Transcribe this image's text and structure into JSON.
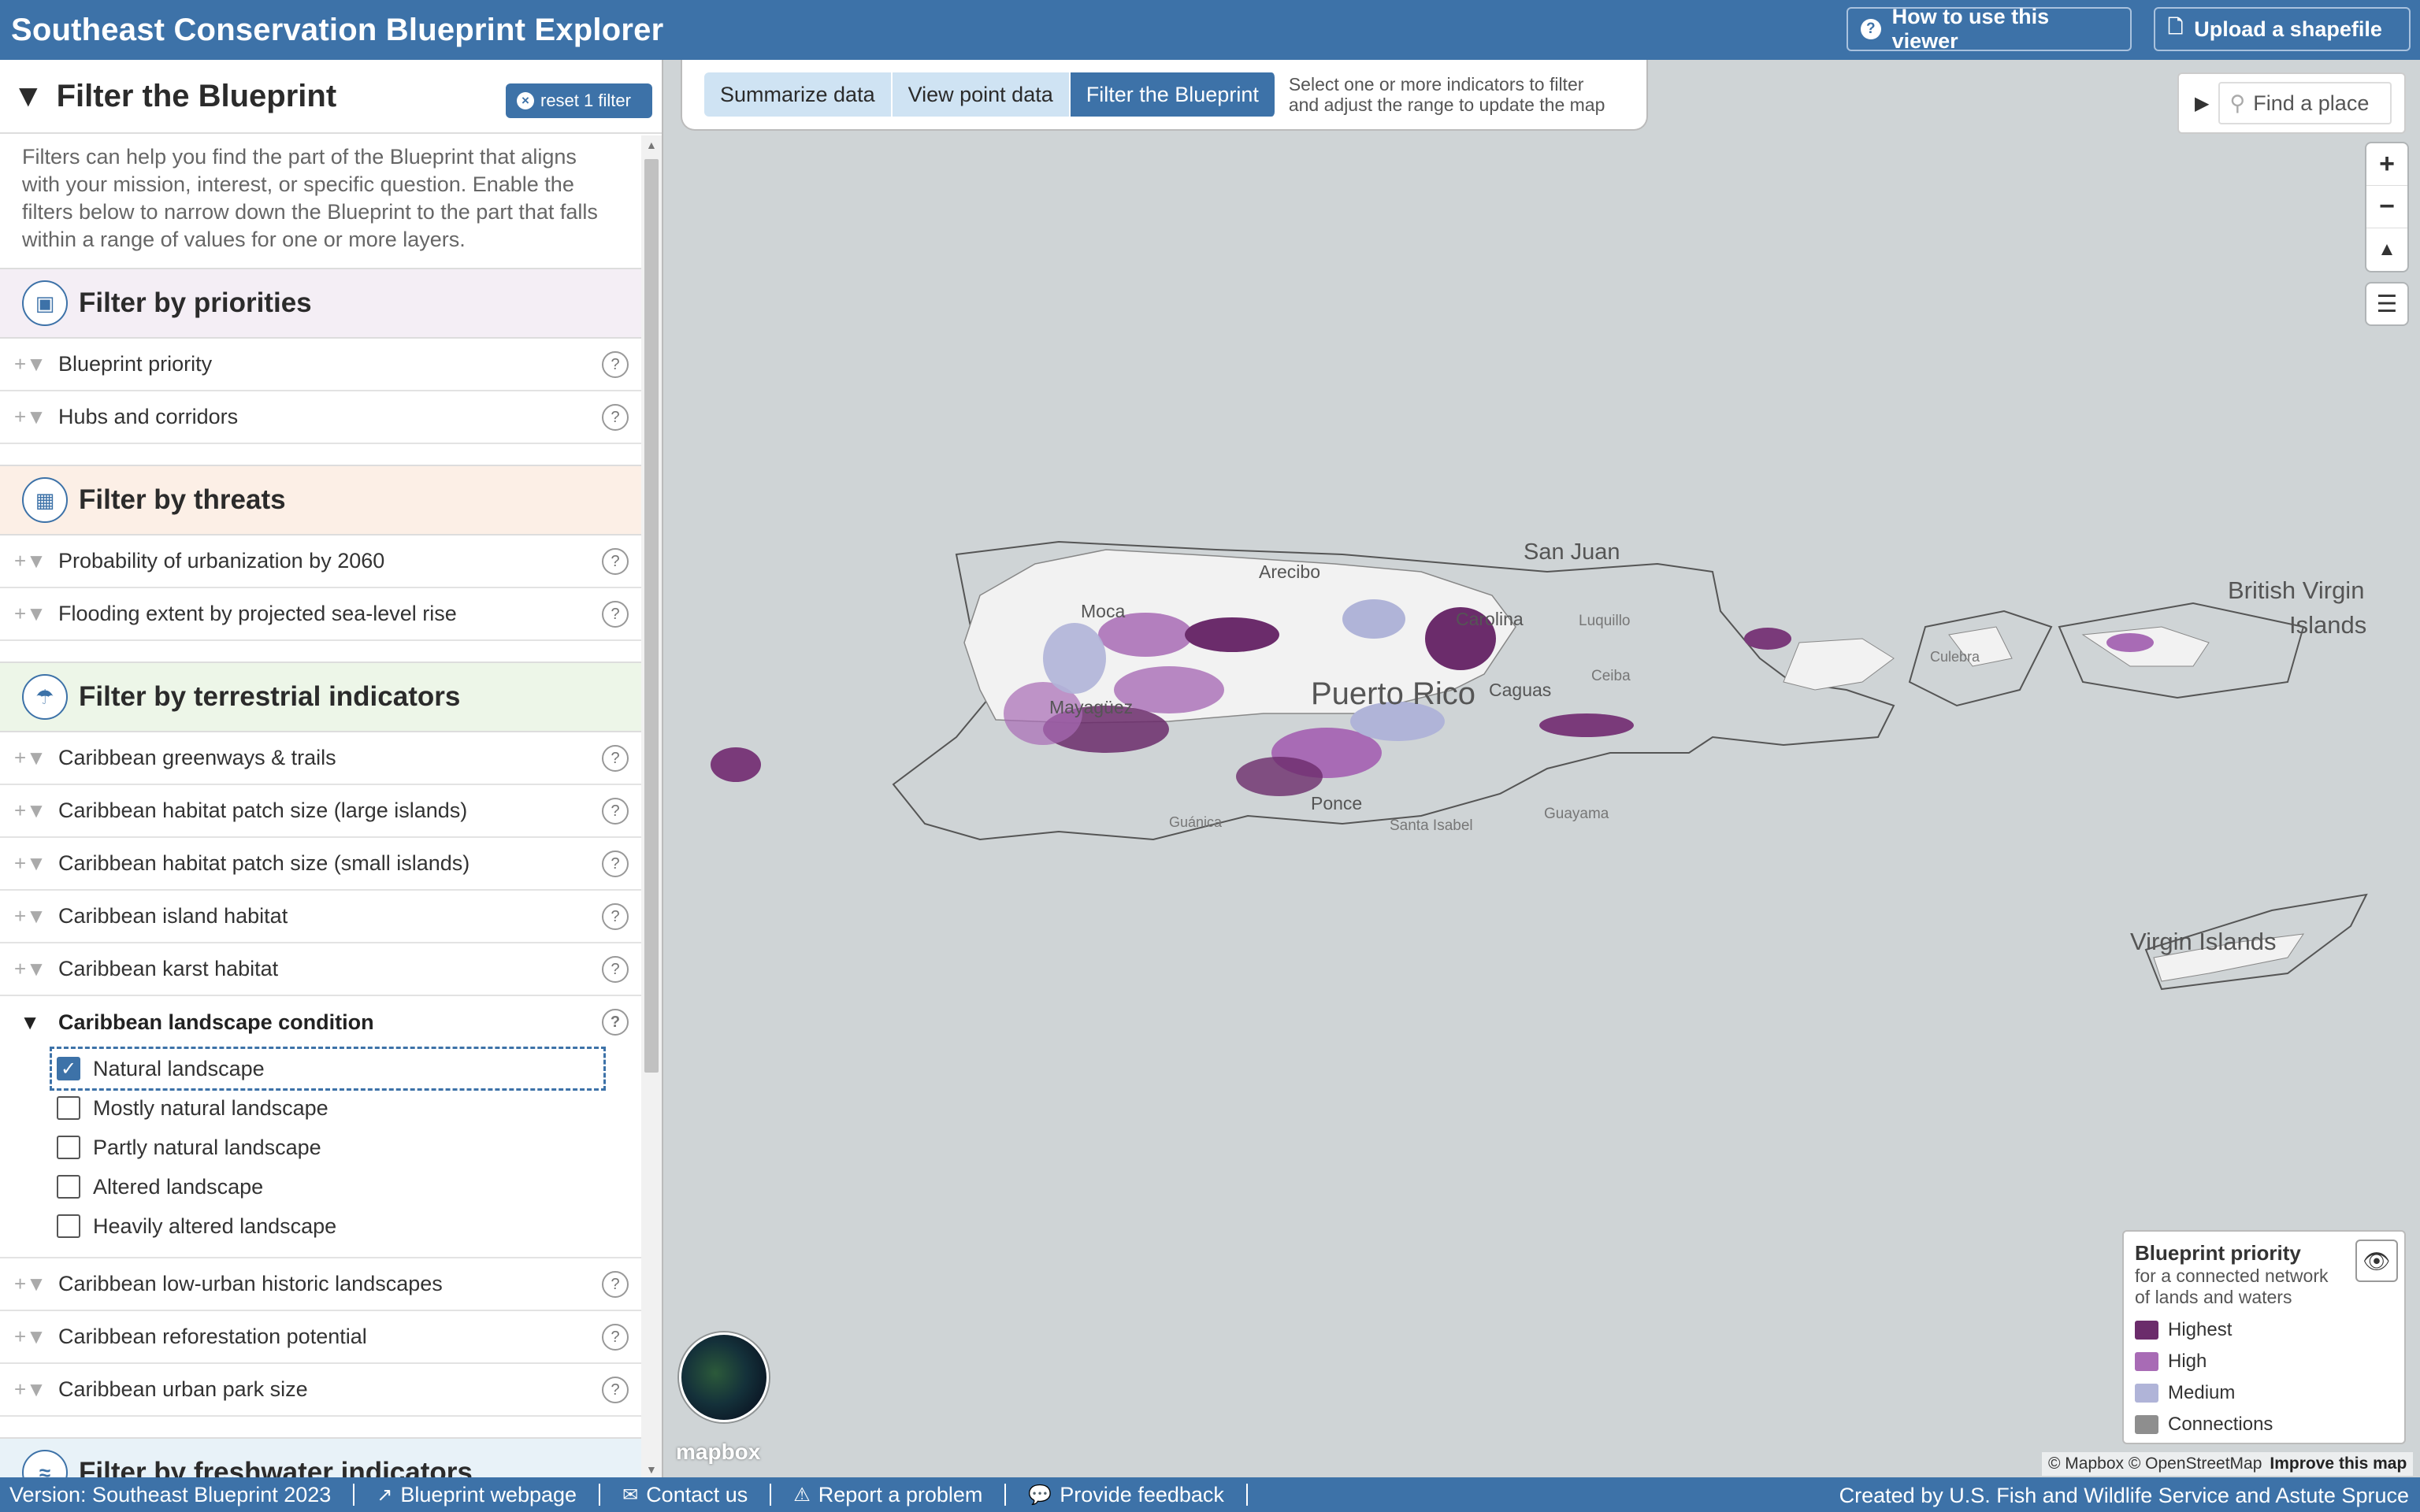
{
  "header": {
    "title": "Southeast  Conservation Blueprint Explorer",
    "help_label": "How to use this viewer",
    "upload_label": "Upload a shapefile"
  },
  "sidebar": {
    "title": "Filter the Blueprint",
    "reset_label": "reset 1 filter",
    "intro": "Filters can help you find the part of the Blueprint that aligns with your mission, interest, or specific question. Enable the filters below to narrow down the Blueprint to the part that falls within a range of values for one or more layers.",
    "sections": {
      "priorities": {
        "title": "Filter by priorities",
        "items": [
          "Blueprint priority",
          "Hubs and corridors"
        ]
      },
      "threats": {
        "title": "Filter by threats",
        "items": [
          "Probability of urbanization by 2060",
          "Flooding extent by projected sea-level rise"
        ]
      },
      "terrestrial": {
        "title": "Filter by terrestrial indicators",
        "items_before": [
          "Caribbean greenways & trails",
          "Caribbean habitat patch size (large islands)",
          "Caribbean habitat patch size (small islands)",
          "Caribbean island habitat",
          "Caribbean karst habitat"
        ],
        "active": {
          "label": "Caribbean landscape condition",
          "options": [
            {
              "label": "Natural landscape",
              "checked": true
            },
            {
              "label": "Mostly natural landscape",
              "checked": false
            },
            {
              "label": "Partly natural landscape",
              "checked": false
            },
            {
              "label": "Altered landscape",
              "checked": false
            },
            {
              "label": "Heavily altered landscape",
              "checked": false
            }
          ]
        },
        "items_after": [
          "Caribbean low-urban historic landscapes",
          "Caribbean reforestation potential",
          "Caribbean urban park size"
        ]
      },
      "freshwater": {
        "title": "Filter by freshwater indicators"
      }
    }
  },
  "modes": {
    "tabs": [
      "Summarize data",
      "View point data",
      "Filter the Blueprint"
    ],
    "active_tab": "Filter the Blueprint",
    "hint_line1": "Select one or more indicators to filter",
    "hint_line2": "and adjust the range to update the map"
  },
  "search": {
    "placeholder": "Find a place"
  },
  "map": {
    "labels": {
      "puerto_rico": "Puerto Rico",
      "san_juan": "San Juan",
      "arecibo": "Arecibo",
      "moca": "Moca",
      "carolina": "Carolina",
      "luquillo": "Luquillo",
      "mayaguez": "Mayagüez",
      "caguas": "Caguas",
      "ceiba": "Ceiba",
      "ponce": "Ponce",
      "guanica": "Guánica",
      "santa_isabel": "Santa Isabel",
      "guayama": "Guayama",
      "culebra": "Culebra",
      "bvi1": "British Virgin",
      "bvi2": "Islands",
      "usvi": "Virgin Islands"
    },
    "logo": "mapbox",
    "attribution": "© Mapbox © OpenStreetMap",
    "improve": "Improve this map"
  },
  "legend": {
    "title": "Blueprint priority",
    "subtitle": "for a connected network of lands and waters",
    "items": [
      {
        "label": "Highest",
        "color": "#6b2c6b"
      },
      {
        "label": "High",
        "color": "#a86bb5"
      },
      {
        "label": "Medium",
        "color": "#b0b4d8"
      },
      {
        "label": "Connections",
        "color": "#8e8e8e"
      }
    ]
  },
  "footer": {
    "version": "Version: Southeast Blueprint 2023",
    "webpage": "Blueprint webpage",
    "contact": "Contact us",
    "report": "Report a problem",
    "feedback": "Provide feedback",
    "credit": "Created by U.S. Fish and Wildlife Service and Astute Spruce"
  }
}
